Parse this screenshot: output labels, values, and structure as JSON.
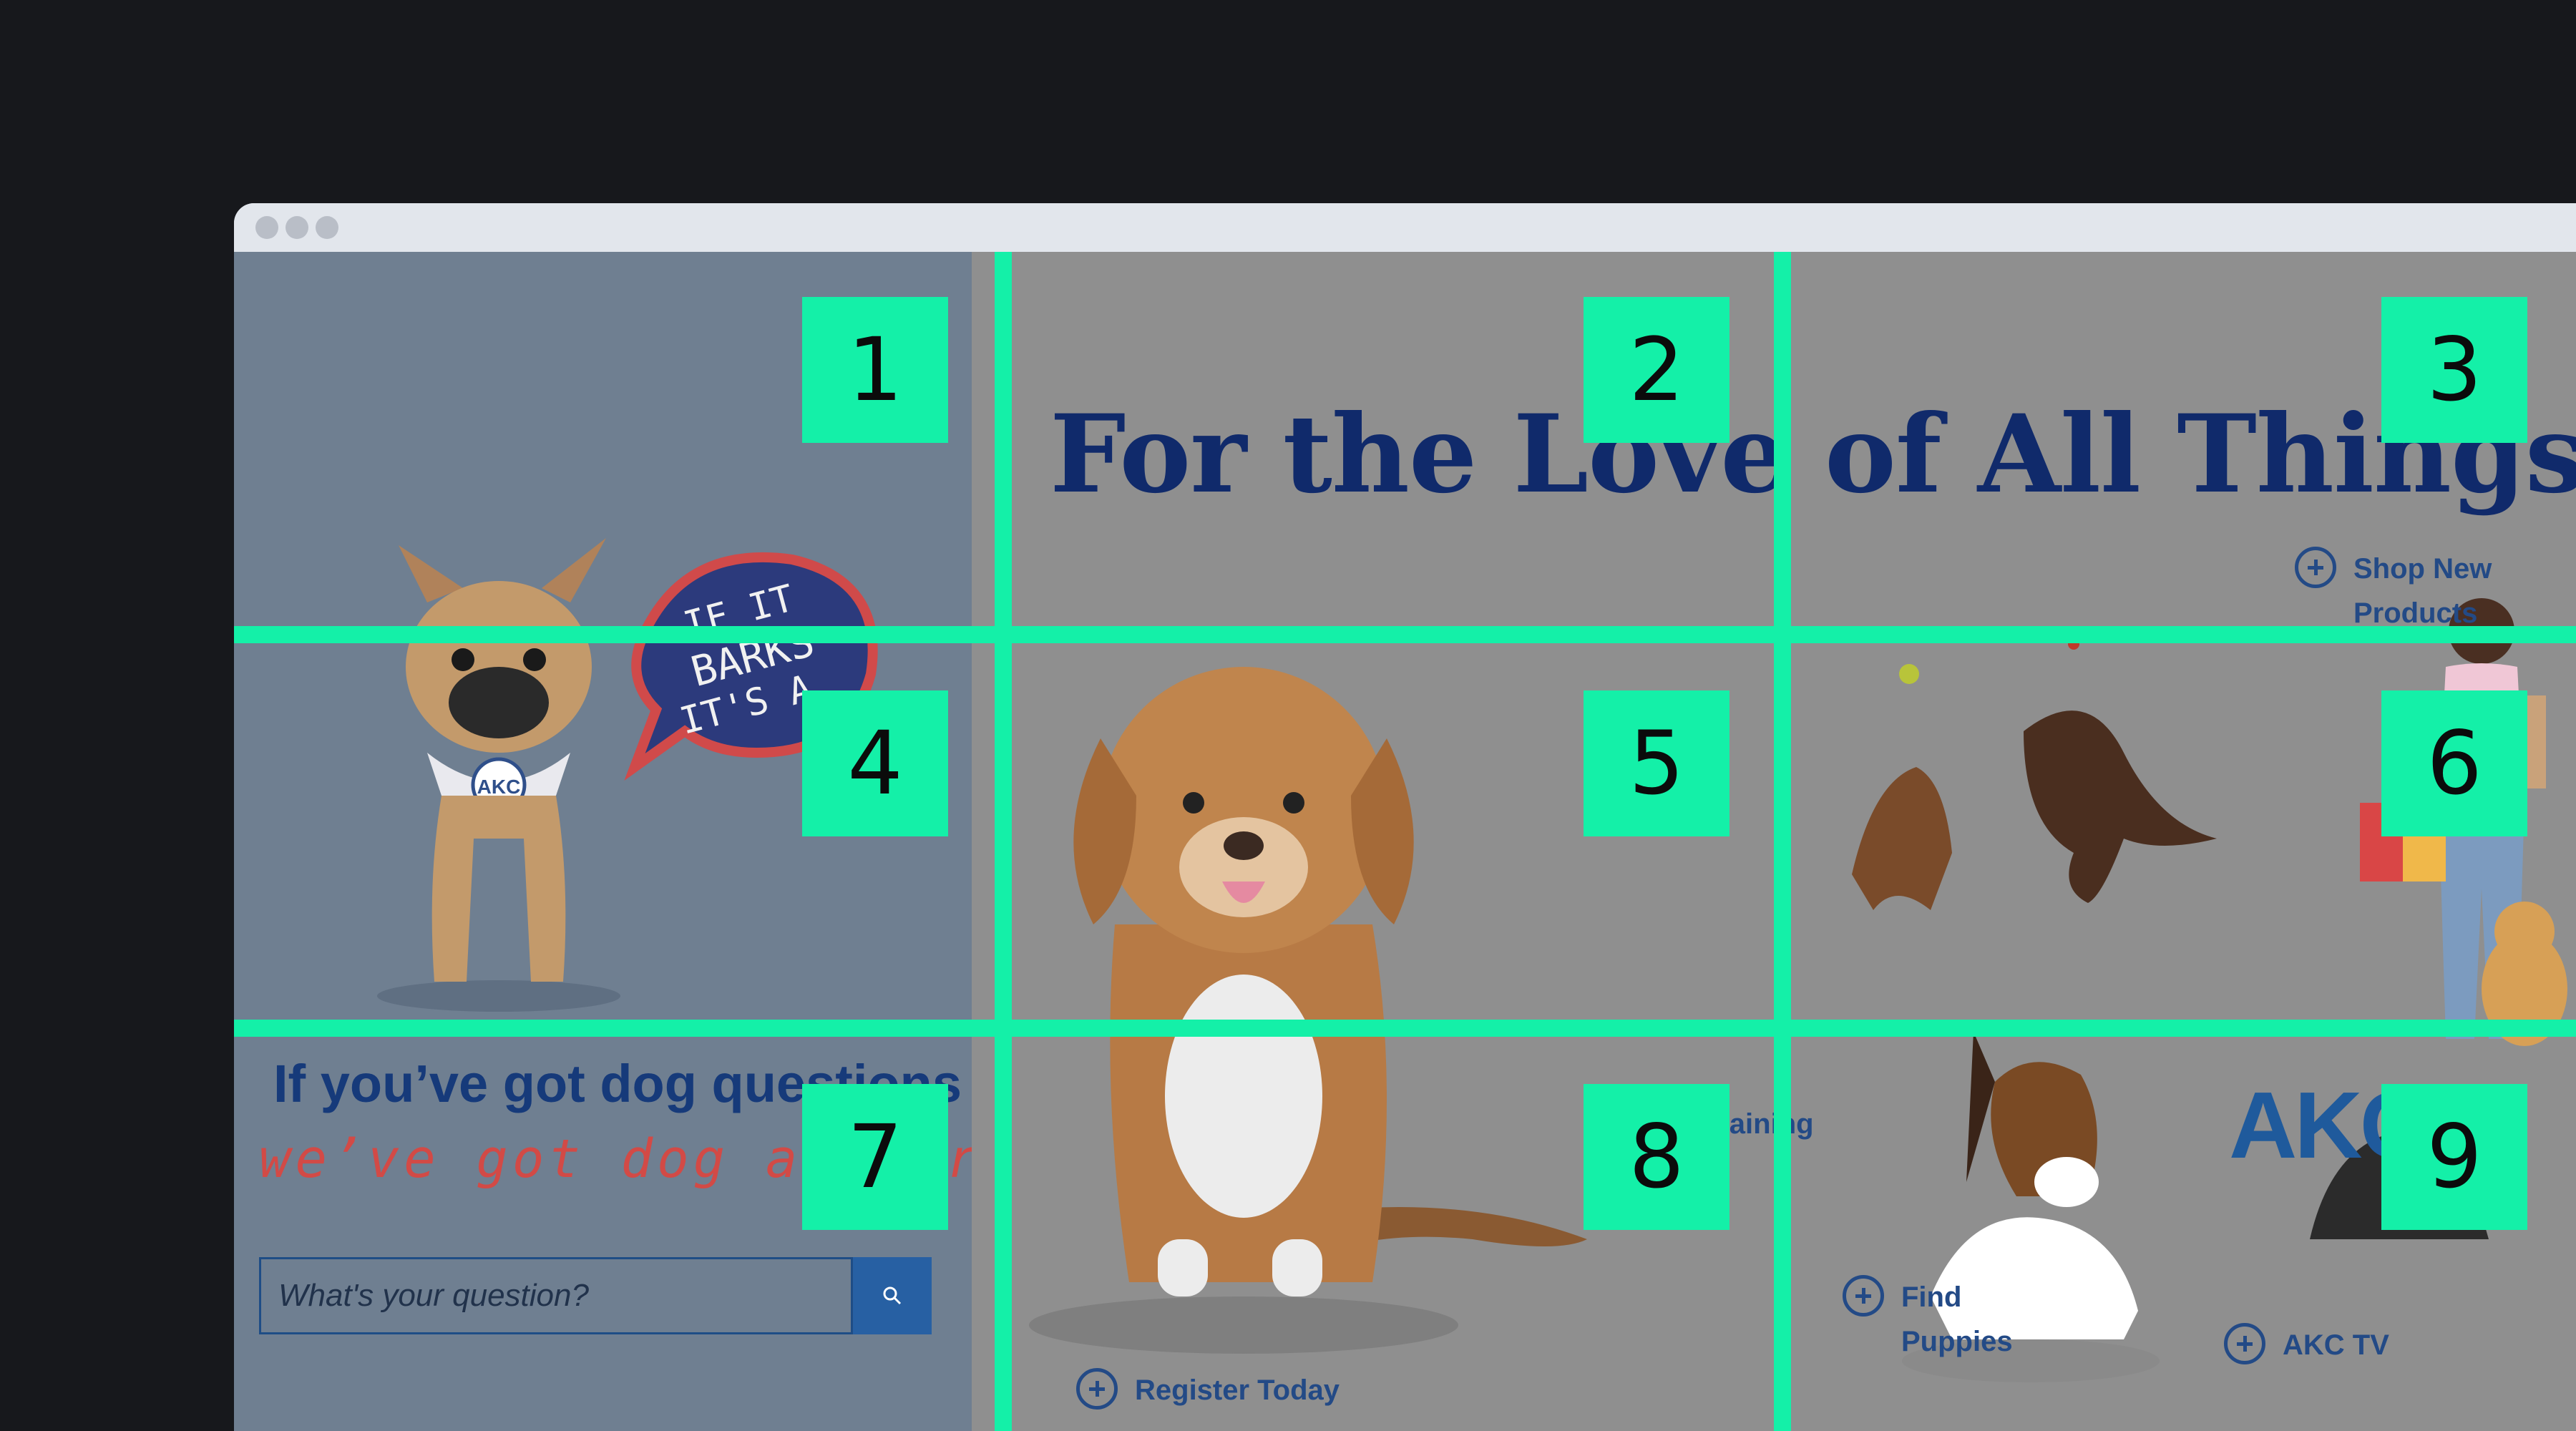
{
  "page": {
    "headline": "For the Love of All Things Dog",
    "links": {
      "shop": [
        "Shop New",
        "Products"
      ],
      "training": "Training",
      "find_puppies": [
        "Find",
        "Puppies"
      ],
      "register": "Register Today",
      "akc_tv": "AKC TV"
    },
    "left_panel": {
      "sticker_text": [
        "IF IT",
        "BARKS",
        "IT'S A"
      ],
      "bandana_badge": "AKC",
      "question_title": "If you’ve got dog questions",
      "question_sub": "we’ve got dog answers",
      "search_placeholder": "What's your question?"
    },
    "logo_text": "AKC"
  },
  "grid_labels": [
    "1",
    "2",
    "3",
    "4",
    "5",
    "6",
    "7",
    "8",
    "9"
  ],
  "colors": {
    "overlay_grid": "#14f0a8",
    "headline": "#102a6b",
    "link": "#234a86",
    "accent_red": "#d24a46",
    "search_button": "#2760a3"
  },
  "icons": {
    "link_icon": "plus-circle-icon",
    "search": "search-icon"
  }
}
